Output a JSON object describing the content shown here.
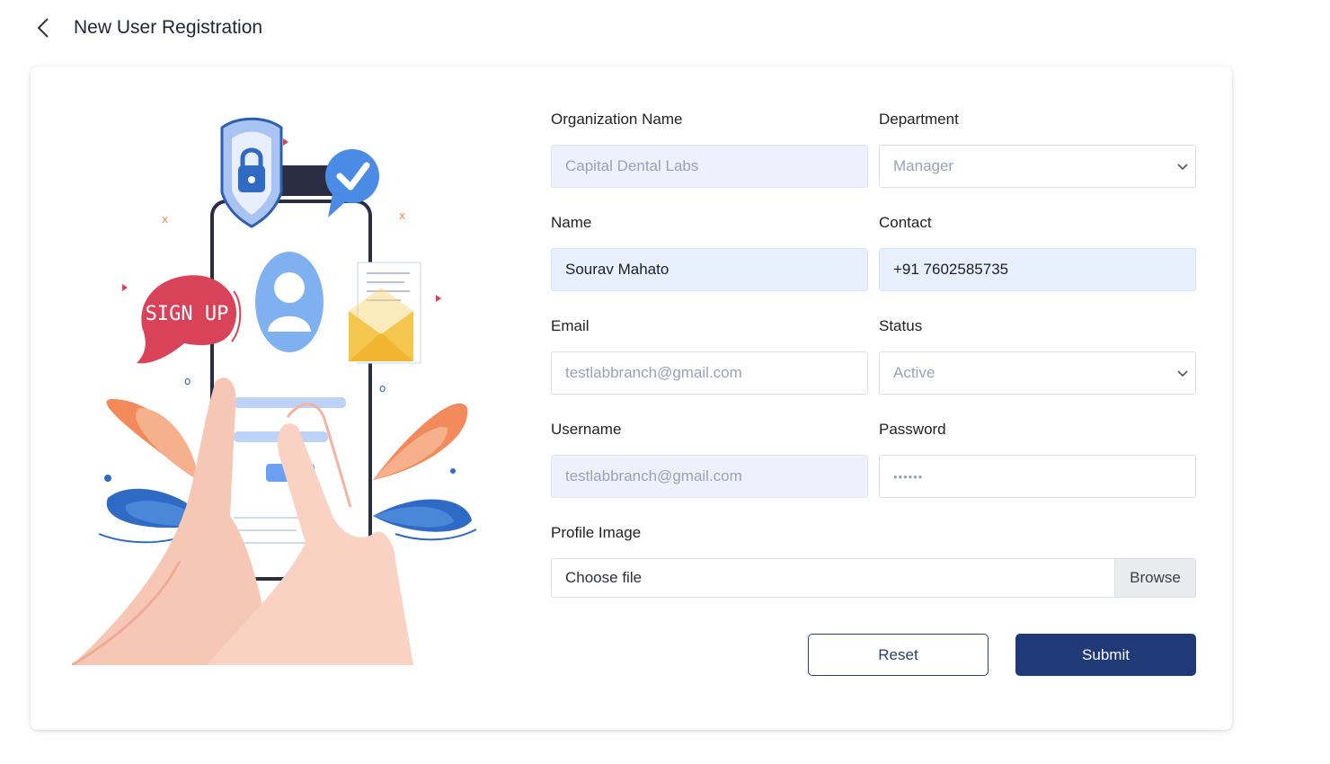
{
  "header": {
    "title": "New User Registration"
  },
  "illustration": {
    "badge_text": "SIGN UP"
  },
  "form": {
    "organization": {
      "label": "Organization Name",
      "value": "Capital Dental Labs"
    },
    "department": {
      "label": "Department",
      "value": "Manager"
    },
    "name": {
      "label": "Name",
      "value": "Sourav Mahato"
    },
    "contact": {
      "label": "Contact",
      "value": "+91 7602585735"
    },
    "email": {
      "label": "Email",
      "value": "testlabbranch@gmail.com"
    },
    "status": {
      "label": "Status",
      "value": "Active"
    },
    "username": {
      "label": "Username",
      "value": "testlabbranch@gmail.com"
    },
    "password": {
      "label": "Password",
      "value": "••••••"
    },
    "profile_image": {
      "label": "Profile Image",
      "file_text": "Choose file",
      "browse_label": "Browse"
    }
  },
  "actions": {
    "reset_label": "Reset",
    "submit_label": "Submit"
  },
  "colors": {
    "primary": "#1f3a77",
    "input_filled_bg": "#e8effd",
    "input_disabled_bg": "#eef1fb",
    "badge_red": "#d9435a"
  }
}
